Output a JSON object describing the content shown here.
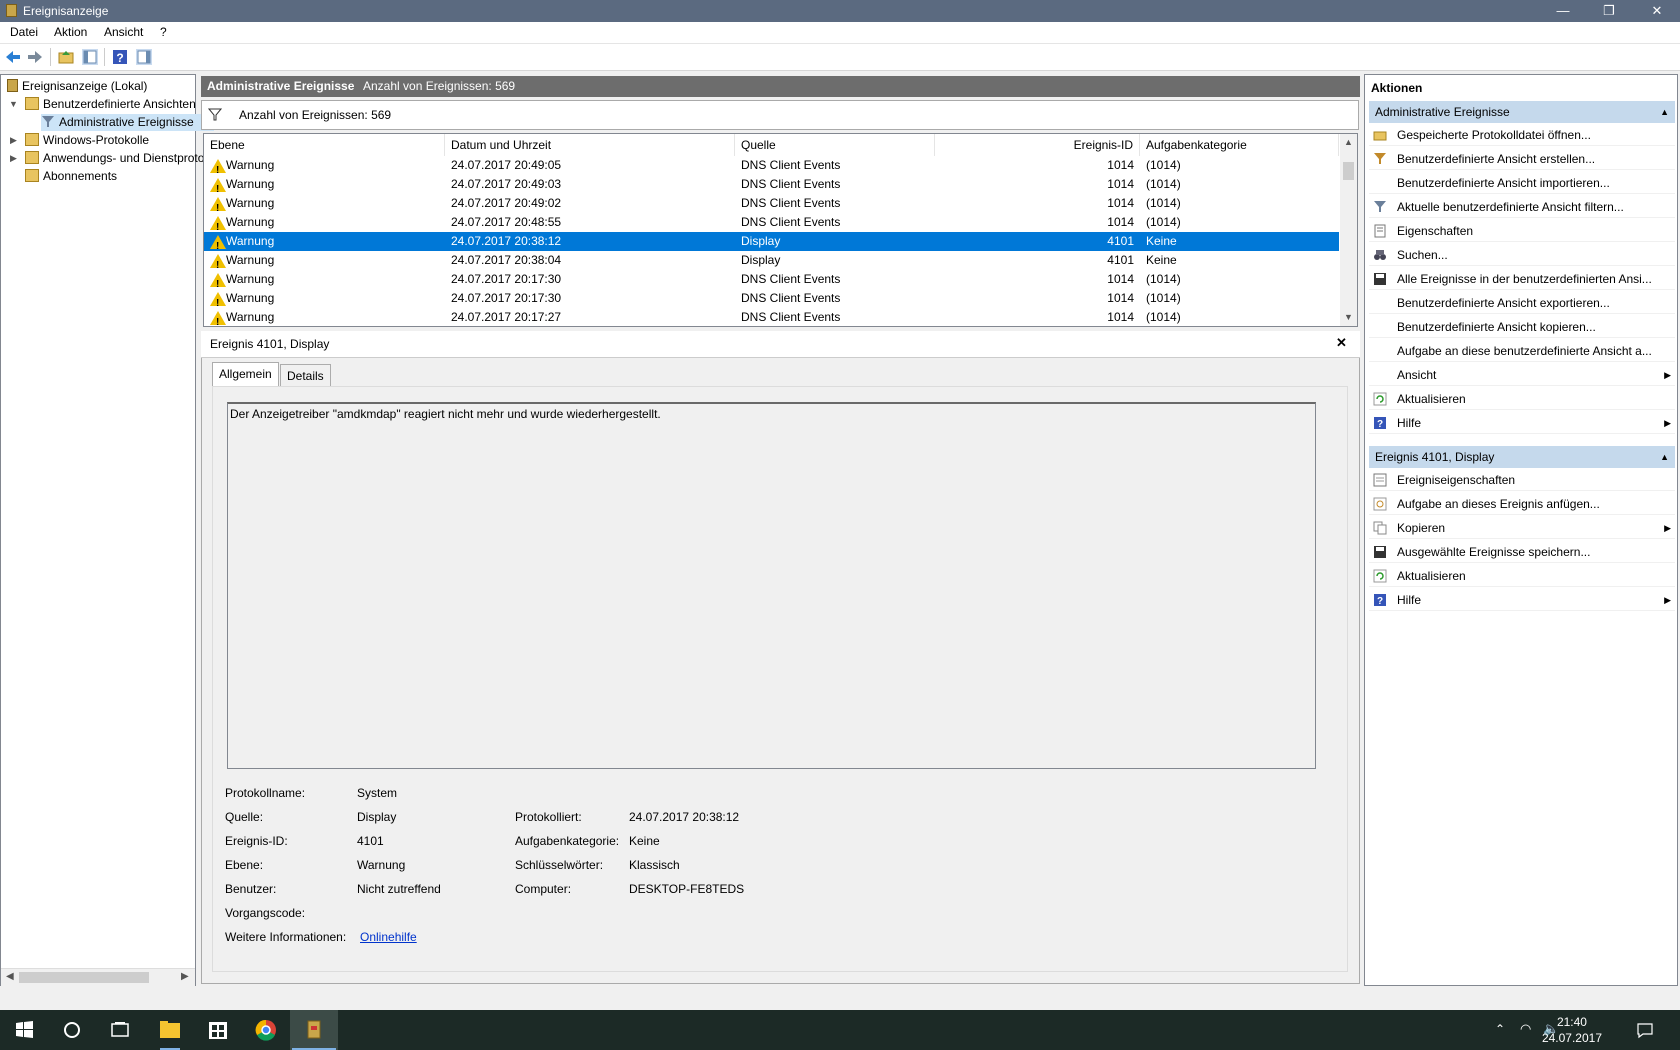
{
  "window": {
    "title": "Ereignisanzeige",
    "minimize": "—",
    "restore": "❐",
    "close": "✕"
  },
  "menu": [
    "Datei",
    "Aktion",
    "Ansicht",
    "?"
  ],
  "tree": {
    "root": "Ereignisanzeige (Lokal)",
    "custom_views": "Benutzerdefinierte Ansichten",
    "admin_events": "Administrative Ereignisse",
    "windows_logs": "Windows-Protokolle",
    "app_logs": "Anwendungs- und Dienstprotokolle",
    "subscriptions": "Abonnements"
  },
  "center": {
    "title": "Administrative Ereignisse",
    "count_label": "Anzahl von Ereignissen: 569",
    "filter_text": "Anzahl von Ereignissen: 569",
    "columns": [
      "Ebene",
      "Datum und Uhrzeit",
      "Quelle",
      "Ereignis-ID",
      "Aufgabenkategorie"
    ],
    "rows": [
      {
        "level": "Warnung",
        "date": "24.07.2017 20:49:05",
        "source": "DNS Client Events",
        "id": "1014",
        "category": "(1014)",
        "selected": false
      },
      {
        "level": "Warnung",
        "date": "24.07.2017 20:49:03",
        "source": "DNS Client Events",
        "id": "1014",
        "category": "(1014)",
        "selected": false
      },
      {
        "level": "Warnung",
        "date": "24.07.2017 20:49:02",
        "source": "DNS Client Events",
        "id": "1014",
        "category": "(1014)",
        "selected": false
      },
      {
        "level": "Warnung",
        "date": "24.07.2017 20:48:55",
        "source": "DNS Client Events",
        "id": "1014",
        "category": "(1014)",
        "selected": false
      },
      {
        "level": "Warnung",
        "date": "24.07.2017 20:38:12",
        "source": "Display",
        "id": "4101",
        "category": "Keine",
        "selected": true
      },
      {
        "level": "Warnung",
        "date": "24.07.2017 20:38:04",
        "source": "Display",
        "id": "4101",
        "category": "Keine",
        "selected": false
      },
      {
        "level": "Warnung",
        "date": "24.07.2017 20:17:30",
        "source": "DNS Client Events",
        "id": "1014",
        "category": "(1014)",
        "selected": false
      },
      {
        "level": "Warnung",
        "date": "24.07.2017 20:17:30",
        "source": "DNS Client Events",
        "id": "1014",
        "category": "(1014)",
        "selected": false
      },
      {
        "level": "Warnung",
        "date": "24.07.2017 20:17:27",
        "source": "DNS Client Events",
        "id": "1014",
        "category": "(1014)",
        "selected": false
      }
    ]
  },
  "detail": {
    "title": "Ereignis 4101, Display",
    "close": "✕",
    "tabs": [
      "Allgemein",
      "Details"
    ],
    "message": "Der Anzeigetreiber \"amdkmdap\" reagiert nicht mehr und wurde wiederhergestellt.",
    "fields": {
      "log_name_label": "Protokollname:",
      "log_name": "System",
      "source_label": "Quelle:",
      "source": "Display",
      "logged_label": "Protokolliert:",
      "logged": "24.07.2017 20:38:12",
      "event_id_label": "Ereignis-ID:",
      "event_id": "4101",
      "task_cat_label": "Aufgabenkategorie:",
      "task_cat": "Keine",
      "level_label": "Ebene:",
      "level": "Warnung",
      "keywords_label": "Schlüsselwörter:",
      "keywords": "Klassisch",
      "user_label": "Benutzer:",
      "user": "Nicht zutreffend",
      "computer_label": "Computer:",
      "computer": "DESKTOP-FE8TEDS",
      "opcode_label": "Vorgangscode:",
      "opcode": "",
      "more_info_label": "Weitere Informationen:",
      "more_info_link": "Onlinehilfe"
    }
  },
  "actions": {
    "title": "Aktionen",
    "section1": "Administrative Ereignisse",
    "items1": [
      {
        "label": "Gespeicherte Protokolldatei öffnen...",
        "icon": "folder-open-icon",
        "submenu": false
      },
      {
        "label": "Benutzerdefinierte Ansicht erstellen...",
        "icon": "filter-create-icon",
        "submenu": false
      },
      {
        "label": "Benutzerdefinierte Ansicht importieren...",
        "icon": "",
        "submenu": false
      },
      {
        "label": "Aktuelle benutzerdefinierte Ansicht filtern...",
        "icon": "filter-icon",
        "submenu": false
      },
      {
        "label": "Eigenschaften",
        "icon": "properties-icon",
        "submenu": false
      },
      {
        "label": "Suchen...",
        "icon": "binoculars-icon",
        "submenu": false
      },
      {
        "label": "Alle Ereignisse in der benutzerdefinierten Ansi...",
        "icon": "save-icon",
        "submenu": false
      },
      {
        "label": "Benutzerdefinierte Ansicht exportieren...",
        "icon": "",
        "submenu": false
      },
      {
        "label": "Benutzerdefinierte Ansicht kopieren...",
        "icon": "",
        "submenu": false
      },
      {
        "label": "Aufgabe an diese benutzerdefinierte Ansicht a...",
        "icon": "",
        "submenu": false
      },
      {
        "label": "Ansicht",
        "icon": "",
        "submenu": true
      },
      {
        "label": "Aktualisieren",
        "icon": "refresh-icon",
        "submenu": false
      },
      {
        "label": "Hilfe",
        "icon": "help-icon",
        "submenu": true
      }
    ],
    "section2": "Ereignis 4101, Display",
    "items2": [
      {
        "label": "Ereigniseigenschaften",
        "icon": "event-properties-icon",
        "submenu": false
      },
      {
        "label": "Aufgabe an dieses Ereignis anfügen...",
        "icon": "task-icon",
        "submenu": false
      },
      {
        "label": "Kopieren",
        "icon": "copy-icon",
        "submenu": true
      },
      {
        "label": "Ausgewählte Ereignisse speichern...",
        "icon": "save-icon",
        "submenu": false
      },
      {
        "label": "Aktualisieren",
        "icon": "refresh-icon",
        "submenu": false
      },
      {
        "label": "Hilfe",
        "icon": "help-icon",
        "submenu": true
      }
    ]
  },
  "taskbar": {
    "time": "21:40",
    "date": "24.07.2017"
  }
}
